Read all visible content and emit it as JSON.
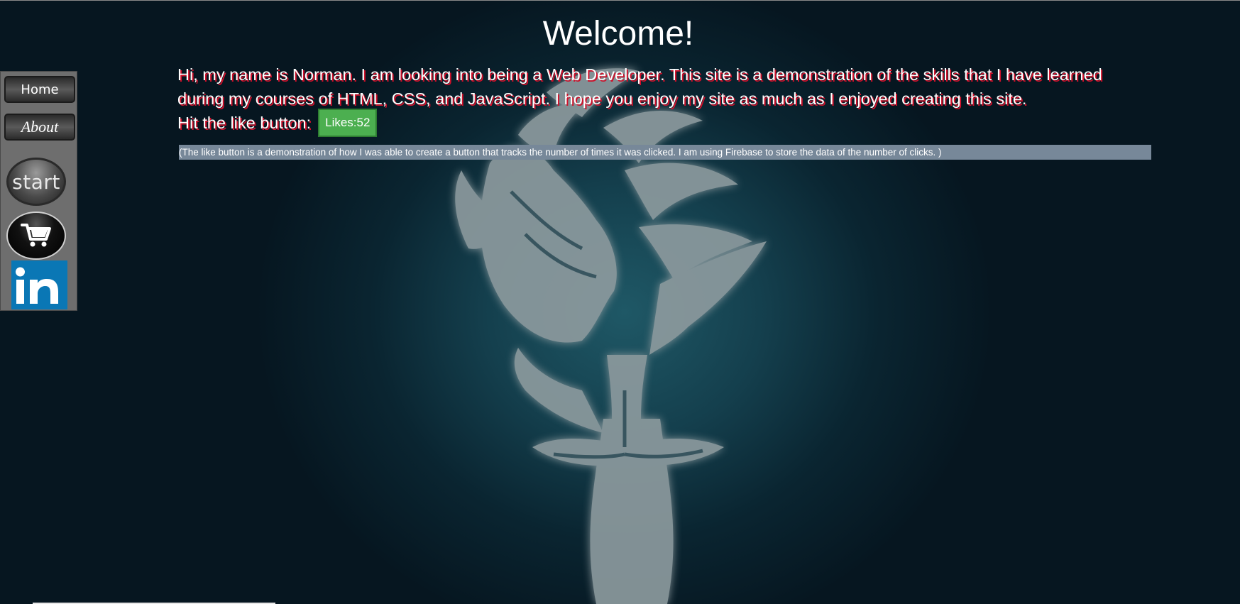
{
  "nav": {
    "home_label": "Home",
    "about_label": "About",
    "start_label": "start",
    "cart_icon": "shopping-cart-icon",
    "linkedin_icon": "linkedin-icon",
    "linkedin_text": "in"
  },
  "main": {
    "title": "Welcome!",
    "intro": "Hi, my name is Norman. I am looking into being a Web Developer. This site is a demonstration of the skills that I have learned during my courses of HTML, CSS, and JavaScript. I hope you enjoy my site as much as I enjoyed creating this site.",
    "like_prompt": "Hit the like button:",
    "like_button": "Likes:52",
    "note": "(The like button is a demonstration of how I was able to create a button that tracks the number of times it was clicked. I am using Firebase to store the data of the number of clicks. )"
  },
  "colors": {
    "background": "#0a2531",
    "sidebar": "#6e6e6e",
    "like_button": "#4caf50",
    "note_background": "#778899",
    "linkedin_blue": "#0a77b5",
    "text_shadow": "#d0102a"
  },
  "background": {
    "emblem_icon": "griever-lion-emblem-icon"
  }
}
